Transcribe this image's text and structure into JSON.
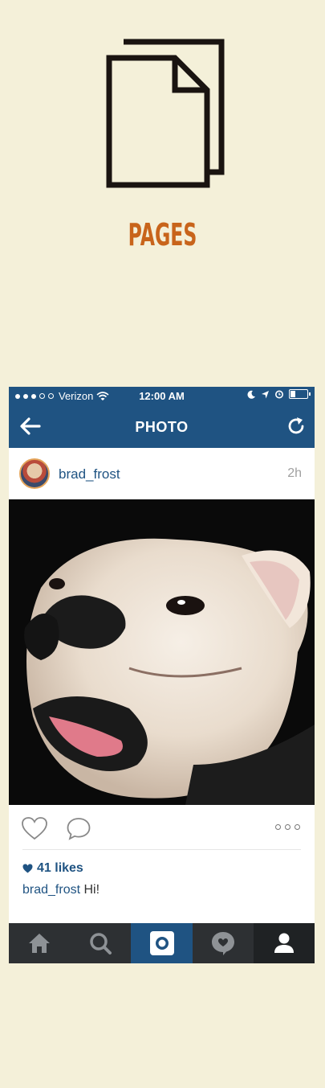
{
  "header": {
    "title": "PAGES",
    "icon": "pages-icon"
  },
  "status_bar": {
    "carrier": "Verizon",
    "time": "12:00 AM"
  },
  "nav": {
    "title": "PHOTO"
  },
  "post": {
    "username": "brad_frost",
    "time_ago": "2h",
    "likes": "41 likes",
    "caption_user": "brad_frost",
    "caption_text": "Hi!"
  },
  "colors": {
    "background": "#f4f0d9",
    "accent": "#c8641b",
    "brand_blue": "#1f5382",
    "tab_bar": "#2d3033"
  },
  "tab_bar": {
    "items": [
      "home-icon",
      "search-icon",
      "camera-icon",
      "activity-icon",
      "profile-icon"
    ],
    "active": "camera-icon"
  }
}
